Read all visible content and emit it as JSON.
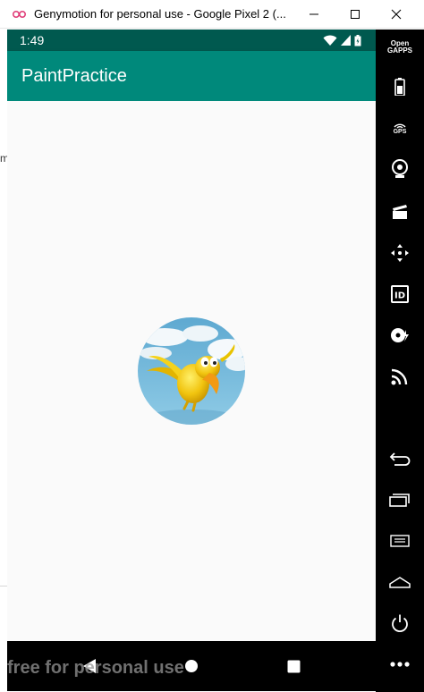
{
  "window": {
    "title": "Genymotion for personal use - Google Pixel 2 (...",
    "buttons": {
      "minimize": "minimize-icon",
      "maximize": "maximize-icon",
      "close": "close-icon"
    }
  },
  "background_window": {
    "visible_fragment": "m"
  },
  "device": {
    "status_bar": {
      "time": "1:49",
      "icons": [
        "wifi-icon",
        "signal-icon",
        "battery-icon"
      ]
    },
    "app_bar": {
      "title": "PaintPractice"
    },
    "content": {
      "image": "bird-avatar-image"
    },
    "nav_bar": {
      "buttons": [
        "back-icon",
        "home-icon",
        "recent-apps-icon"
      ]
    },
    "watermark": "free for personal use"
  },
  "sidebar": {
    "opengapps_line1": "Open",
    "opengapps_line2": "GAPPS",
    "gps_label": "GPS",
    "id_label": "ID",
    "items": [
      "opengapps-button",
      "battery-button",
      "gps-button",
      "webcam-button",
      "screencast-button",
      "dpad-button",
      "device-id-button",
      "disk-io-button",
      "network-button",
      "back-button",
      "recent-apps-button",
      "menu-button",
      "home-button",
      "power-button",
      "more-button"
    ]
  },
  "colors": {
    "status_bar": "#00594f",
    "app_bar": "#00897b",
    "content_background": "#fafafa",
    "toolbar_background": "#000000"
  }
}
